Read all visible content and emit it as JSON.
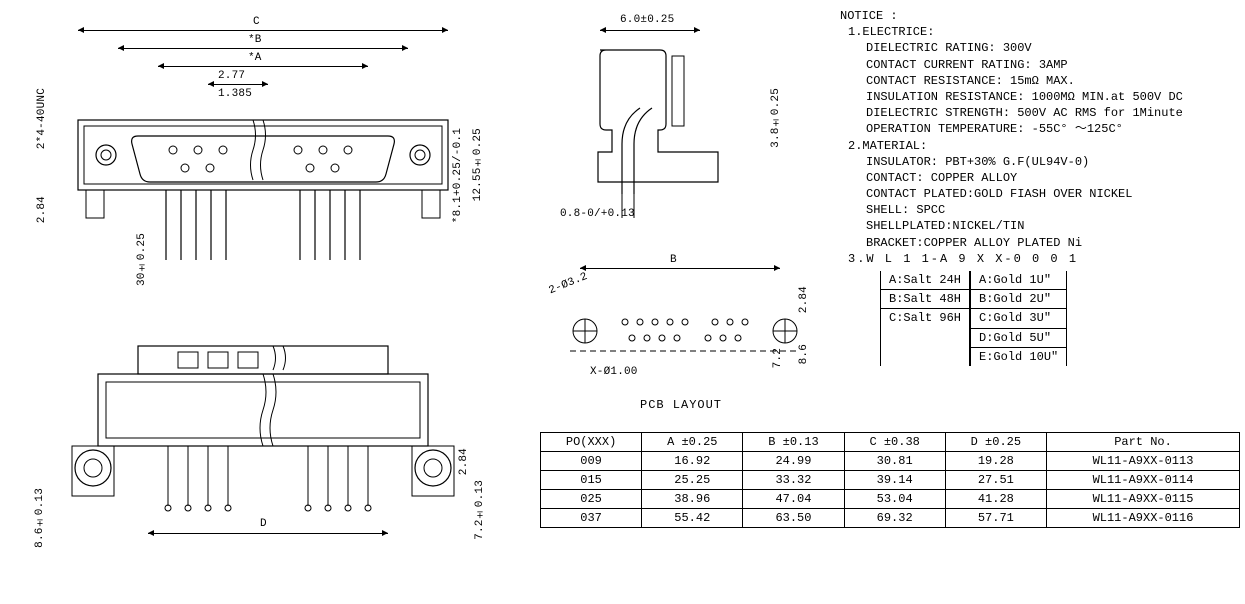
{
  "dimensions": {
    "front_view": {
      "C": "C",
      "B": "*B",
      "A": "*A",
      "pitch": "2.77",
      "half_pitch": "1.385",
      "thread": "2*4-40UNC",
      "left_dim": "2.84",
      "pin_len": "30±0.25",
      "height_inner": "*8.1+0.25/-0.1",
      "height_outer": "12.55±0.25"
    },
    "side_view": {
      "width": "6.0±0.25",
      "height": "3.8±0.25",
      "thickness": "0.8-0/+0.13"
    },
    "bottom_view": {
      "D": "D",
      "left1": "8.6±0.13",
      "right1": "2.84",
      "right2": "7.2±0.13"
    },
    "pcb": {
      "label": "PCB LAYOUT",
      "B": "B",
      "hole1": "2-Ø3.2",
      "hole2": "X-Ø1.00",
      "right1": "2.84",
      "right2": "7.2",
      "right3": "8.6"
    }
  },
  "notice": {
    "title": "NOTICE :",
    "electrice_hdr": "1.ELECTRICE:",
    "dielectric_rating": "DIELECTRIC RATING: 300V",
    "contact_current": "CONTACT CURRENT RATING: 3AMP",
    "contact_resistance": "CONTACT RESISTANCE: 15mΩ MAX.",
    "insulation_resistance": "INSULATION RESISTANCE: 1000MΩ MIN.at 500V DC",
    "dielectric_strength": "DIELECTRIC STRENGTH: 500V AC RMS for 1Minute",
    "operation_temp": "OPERATION TEMPERATURE: -55C° ～125C°",
    "material_hdr": "2.MATERIAL:",
    "insulator": "INSULATOR: PBT+30% G.F(UL94V-0)",
    "contact": "CONTACT: COPPER ALLOY",
    "contact_plated": "CONTACT PLATED:GOLD FIASH OVER NICKEL",
    "shell": "SHELL: SPCC",
    "shell_plated": "SHELLPLATED:NICKEL/TIN",
    "bracket": "BRACKET:COPPER ALLOY PLATED Ni",
    "partcode_hdr": "3.W L 1 1-A 9 X X-0 0 0 1",
    "salt": [
      "A:Salt 24H",
      "B:Salt 48H",
      "C:Salt 96H"
    ],
    "gold": [
      "A:Gold 1U″",
      "B:Gold 2U″",
      "C:Gold 3U″",
      "D:Gold 5U″",
      "E:Gold 10U″"
    ]
  },
  "table": {
    "headers": [
      "PO(XXX)",
      "A ±0.25",
      "B ±0.13",
      "C ±0.38",
      "D ±0.25",
      "Part   No."
    ],
    "rows": [
      [
        "009",
        "16.92",
        "24.99",
        "30.81",
        "19.28",
        "WL11-A9XX-0113"
      ],
      [
        "015",
        "25.25",
        "33.32",
        "39.14",
        "27.51",
        "WL11-A9XX-0114"
      ],
      [
        "025",
        "38.96",
        "47.04",
        "53.04",
        "41.28",
        "WL11-A9XX-0115"
      ],
      [
        "037",
        "55.42",
        "63.50",
        "69.32",
        "57.71",
        "WL11-A9XX-0116"
      ]
    ]
  },
  "chart_data": {
    "type": "table",
    "title": "D-Sub connector dimensional variants",
    "columns": [
      "PO(XXX)",
      "A ±0.25",
      "B ±0.13",
      "C ±0.38",
      "D ±0.25",
      "Part No."
    ],
    "rows": [
      {
        "po": "009",
        "A": 16.92,
        "B": 24.99,
        "C": 30.81,
        "D": 19.28,
        "part": "WL11-A9XX-0113"
      },
      {
        "po": "015",
        "A": 25.25,
        "B": 33.32,
        "C": 39.14,
        "D": 27.51,
        "part": "WL11-A9XX-0114"
      },
      {
        "po": "025",
        "A": 38.96,
        "B": 47.04,
        "C": 53.04,
        "D": 41.28,
        "part": "WL11-A9XX-0115"
      },
      {
        "po": "037",
        "A": 55.42,
        "B": 63.5,
        "C": 69.32,
        "D": 57.71,
        "part": "WL11-A9XX-0116"
      }
    ]
  }
}
